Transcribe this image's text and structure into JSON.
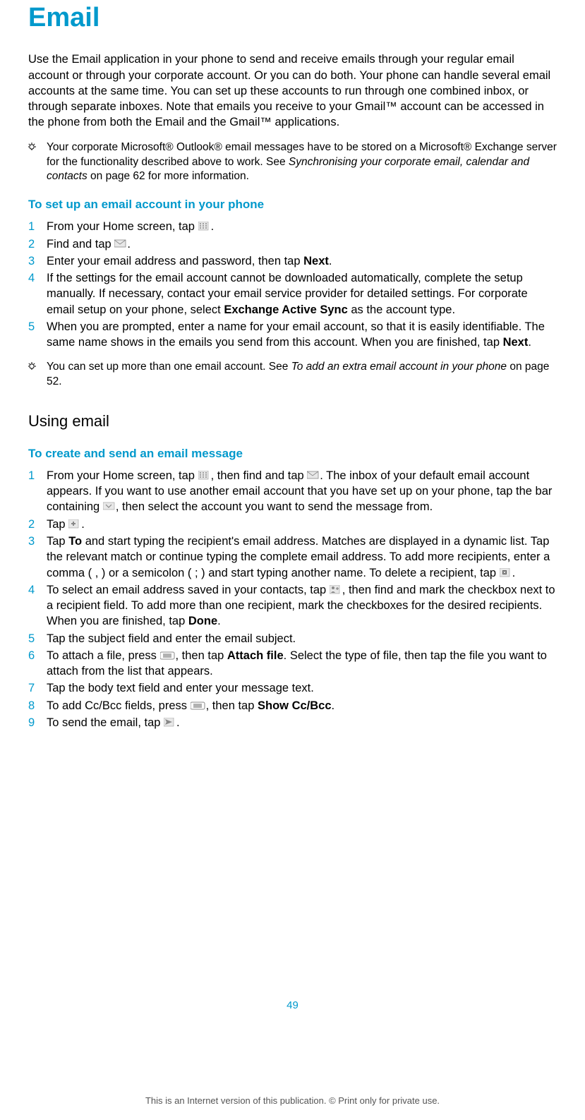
{
  "title": "Email",
  "intro": "Use the Email application in your phone to send and receive emails through your regular email account or through your corporate account. Or you can do both. Your phone can handle several email accounts at the same time. You can set up these accounts to run through one combined inbox, or through separate inboxes. Note that emails you receive to your Gmail™ account can be accessed in the phone from both the Email and the Gmail™ applications.",
  "tip1_pre": "Your corporate Microsoft® Outlook® email messages have to be stored on a Microsoft® Exchange server for the functionality described above to work. See ",
  "tip1_italic": "Synchronising your corporate email, calendar and contacts",
  "tip1_post": " on page 62 for more information.",
  "heading_setup": "To set up an email account in your phone",
  "setup_steps": {
    "s1_a": "From your Home screen, tap ",
    "s1_b": ".",
    "s2_a": "Find and tap ",
    "s2_b": ".",
    "s3_a": "Enter your email address and password, then tap ",
    "s3_bold": "Next",
    "s3_b": ".",
    "s4_a": "If the settings for the email account cannot be downloaded automatically, complete the setup manually. If necessary, contact your email service provider for detailed settings. For corporate email setup on your phone, select ",
    "s4_bold": "Exchange Active Sync",
    "s4_b": " as the account type.",
    "s5_a": "When you are prompted, enter a name for your email account, so that it is easily identifiable. The same name shows in the emails you send from this account. When you are finished, tap ",
    "s5_bold": "Next",
    "s5_b": "."
  },
  "tip2_pre": "You can set up more than one email account. See ",
  "tip2_italic": "To add an extra email account in your phone",
  "tip2_post": " on page 52.",
  "subsection": "Using email",
  "heading_create": "To create and send an email message",
  "create_steps": {
    "s1_a": "From your Home screen, tap ",
    "s1_b": ", then find and tap ",
    "s1_c": ". The inbox of your default email account appears. If you want to use another email account that you have set up on your phone, tap the bar containing ",
    "s1_d": ", then select the account you want to send the message from.",
    "s2_a": "Tap ",
    "s2_b": ".",
    "s3_a": "Tap ",
    "s3_bold": "To",
    "s3_b": " and start typing the recipient's email address. Matches are displayed in a dynamic list. Tap the relevant match or continue typing the complete email address. To add more recipients, enter a comma ( , ) or a semicolon ( ; ) and start typing another name. To delete a recipient, tap ",
    "s3_c": ".",
    "s4_a": "To select an email address saved in your contacts, tap ",
    "s4_b": ", then find and mark the checkbox next to a recipient field. To add more than one recipient, mark the checkboxes for the desired recipients. When you are finished, tap ",
    "s4_bold": "Done",
    "s4_c": ".",
    "s5": "Tap the subject field and enter the email subject.",
    "s6_a": "To attach a file, press ",
    "s6_b": ", then tap ",
    "s6_bold": "Attach file",
    "s6_c": ". Select the type of file, then tap the file you want to attach from the list that appears.",
    "s7": "Tap the body text field and enter your message text.",
    "s8_a": "To add Cc/Bcc fields, press ",
    "s8_b": ", then tap ",
    "s8_bold": "Show Cc/Bcc",
    "s8_c": ".",
    "s9_a": "To send the email, tap ",
    "s9_b": "."
  },
  "page_number": "49",
  "footer": "This is an Internet version of this publication. © Print only for private use."
}
